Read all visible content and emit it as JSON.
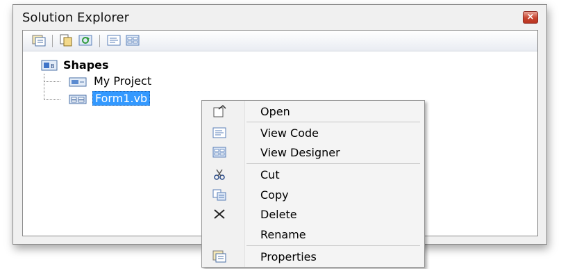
{
  "window": {
    "title": "Solution Explorer",
    "close_glyph": "×"
  },
  "toolbar": {
    "buttons": [
      {
        "icon": "properties-icon"
      },
      {
        "icon": "show-all-files-icon"
      },
      {
        "icon": "refresh-icon"
      },
      {
        "icon": "view-code-icon"
      },
      {
        "icon": "view-designer-icon"
      }
    ]
  },
  "tree": {
    "root": {
      "label": "Shapes",
      "icon": "vb-project-icon"
    },
    "children": [
      {
        "label": "My Project",
        "icon": "my-project-icon"
      },
      {
        "label": "Form1.vb",
        "icon": "form-icon",
        "selected": true
      }
    ]
  },
  "context_menu": {
    "items": [
      {
        "label": "Open",
        "icon": "open-icon"
      },
      {
        "label": "View Code",
        "icon": "view-code-icon"
      },
      {
        "label": "View Designer",
        "icon": "view-designer-icon"
      },
      {
        "label": "Cut",
        "icon": "scissors-icon"
      },
      {
        "label": "Copy",
        "icon": "copy-icon"
      },
      {
        "label": "Delete",
        "icon": "delete-x-icon"
      },
      {
        "label": "Rename",
        "icon": ""
      },
      {
        "label": "Properties",
        "icon": "properties-icon"
      }
    ]
  },
  "colors": {
    "selection": "#3399ff",
    "close_button": "#c8442f"
  }
}
